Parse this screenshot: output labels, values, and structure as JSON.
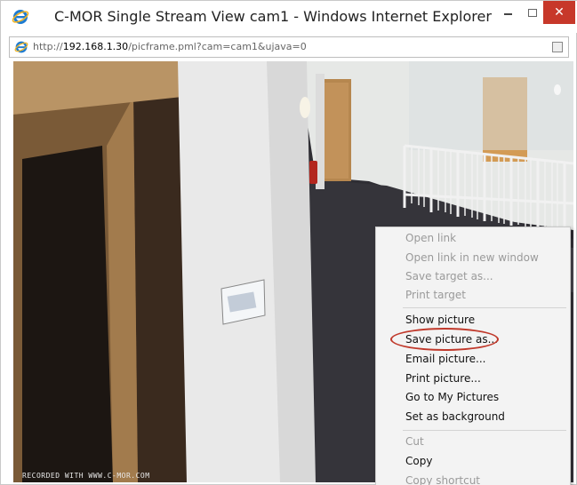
{
  "window": {
    "title": "C-MOR Single Stream View cam1 - Windows Internet Explorer",
    "close_symbol": "✕"
  },
  "address": {
    "scheme": "http://",
    "host": "192.168.1.30",
    "path": "/picframe.pml?cam=cam1&ujava=0"
  },
  "icons": {
    "browser": "ie-icon",
    "compatibility": "compatibility-view-icon"
  },
  "camera": {
    "watermark": "RECORDED WITH WWW.C-MOR.COM"
  },
  "context_menu": {
    "items": [
      {
        "label": "Open link",
        "enabled": false
      },
      {
        "label": "Open link in new window",
        "enabled": false
      },
      {
        "label": "Save target as...",
        "enabled": false
      },
      {
        "label": "Print target",
        "enabled": false
      },
      {
        "label": "Show picture",
        "enabled": true
      },
      {
        "label": "Save picture as...",
        "enabled": true,
        "highlighted": true
      },
      {
        "label": "Email picture...",
        "enabled": true
      },
      {
        "label": "Print picture...",
        "enabled": true
      },
      {
        "label": "Go to My Pictures",
        "enabled": true
      },
      {
        "label": "Set as background",
        "enabled": true
      },
      {
        "label": "Cut",
        "enabled": false
      },
      {
        "label": "Copy",
        "enabled": true
      },
      {
        "label": "Copy shortcut",
        "enabled": false
      }
    ]
  },
  "colors": {
    "close_button": "#c7382a",
    "annotation_ring": "#c0392b",
    "ie_blue": "#1e7bd0",
    "ie_gold": "#f0b323"
  }
}
